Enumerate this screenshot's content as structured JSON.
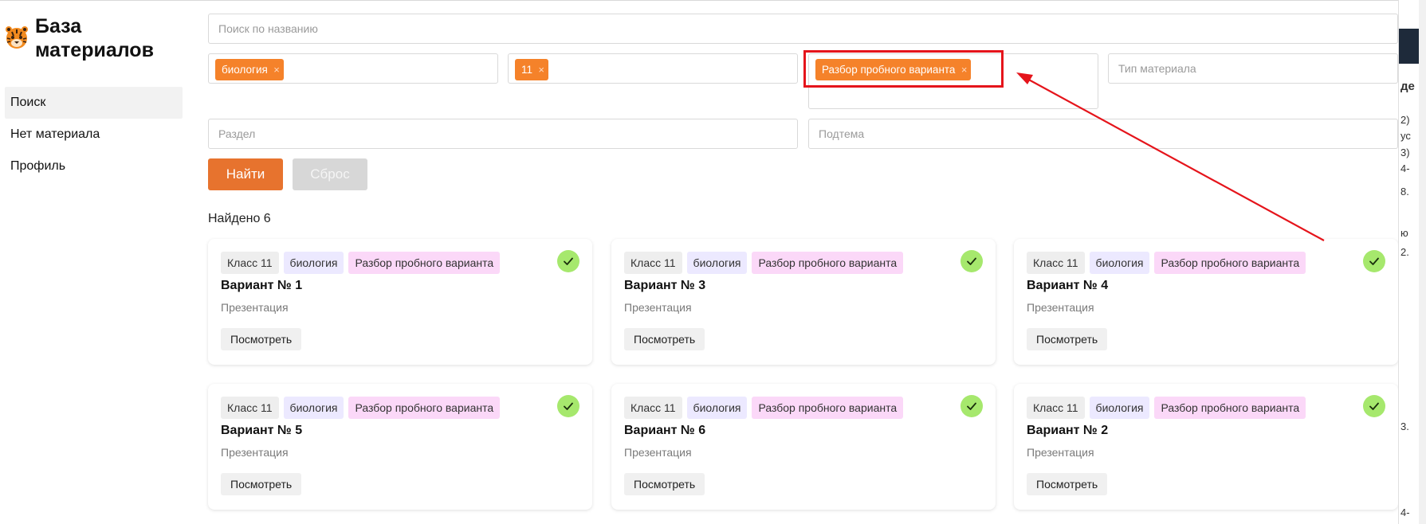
{
  "sidebar": {
    "brand_title_line1": "База",
    "brand_title_line2": "материалов",
    "items": [
      {
        "label": "Поиск",
        "active": true
      },
      {
        "label": "Нет материала",
        "active": false
      },
      {
        "label": "Профиль",
        "active": false
      }
    ]
  },
  "filters": {
    "search_placeholder": "Поиск по названию",
    "subject_chip": "биология",
    "grade_chip": "11",
    "category_chip": "Разбор пробного варианта",
    "type_placeholder": "Тип материала",
    "section_placeholder": "Раздел",
    "subtopic_placeholder": "Подтема",
    "chip_remove": "×",
    "find_label": "Найти",
    "reset_label": "Сброс"
  },
  "results": {
    "found_text": "Найдено 6",
    "cards": [
      {
        "grade": "Класс 11",
        "subject": "биология",
        "type": "Разбор пробного варианта",
        "title": "Вариант № 1",
        "kind": "Презентация",
        "button": "Посмотреть"
      },
      {
        "grade": "Класс 11",
        "subject": "биология",
        "type": "Разбор пробного варианта",
        "title": "Вариант № 3",
        "kind": "Презентация",
        "button": "Посмотреть"
      },
      {
        "grade": "Класс 11",
        "subject": "биология",
        "type": "Разбор пробного варианта",
        "title": "Вариант № 4",
        "kind": "Презентация",
        "button": "Посмотреть"
      },
      {
        "grade": "Класс 11",
        "subject": "биология",
        "type": "Разбор пробного варианта",
        "title": "Вариант № 5",
        "kind": "Презентация",
        "button": "Посмотреть"
      },
      {
        "grade": "Класс 11",
        "subject": "биология",
        "type": "Разбор пробного варианта",
        "title": "Вариант № 6",
        "kind": "Презентация",
        "button": "Посмотреть"
      },
      {
        "grade": "Класс 11",
        "subject": "биология",
        "type": "Разбор пробного варианта",
        "title": "Вариант № 2",
        "kind": "Презентация",
        "button": "Посмотреть"
      }
    ]
  },
  "right_edge": {
    "lines": [
      "де",
      "2)",
      "ус",
      "3)",
      "4-",
      "8.",
      "ю",
      "2.",
      "3.",
      "4-"
    ]
  },
  "colors": {
    "accent": "#e7732e",
    "chip": "#f5822a",
    "check": "#a6e86d",
    "annotation": "#e5141b"
  },
  "icons": {
    "logo": "tiger-logo-icon",
    "check": "check-icon",
    "remove": "close-icon"
  }
}
